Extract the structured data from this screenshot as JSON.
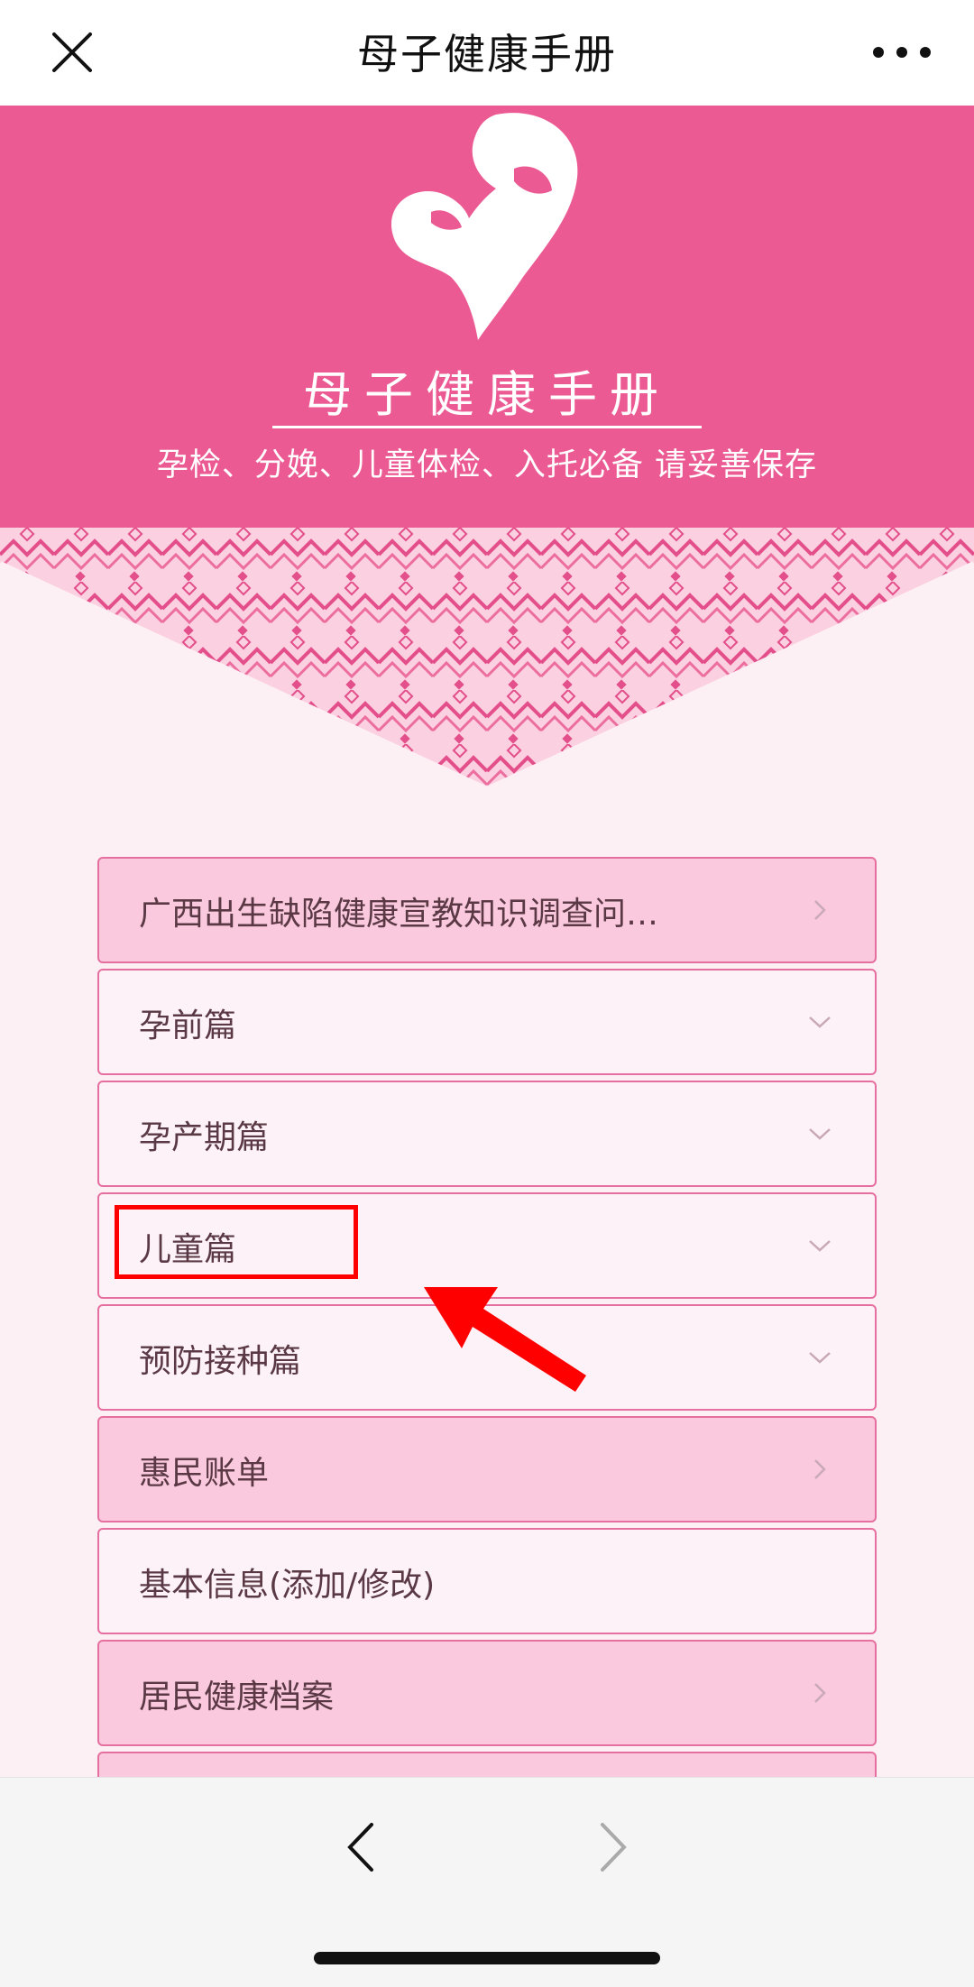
{
  "window": {
    "title": "母子健康手册"
  },
  "header": {
    "app_title": "母子健康手册",
    "subtitle": "孕检、分娩、儿童体检、入托必备 请妥善保存"
  },
  "colors": {
    "brand_pink": "#ec5a93",
    "menu_filled": "#fbc9dd",
    "menu_border": "#e56f9e",
    "annotation_red": "#ff0000"
  },
  "menu": {
    "items": [
      {
        "label": "广西出生缺陷健康宣教知识调查问…",
        "style": "filled",
        "icon": "chevron-right-icon"
      },
      {
        "label": "孕前篇",
        "style": "plain",
        "icon": "chevron-down-icon"
      },
      {
        "label": "孕产期篇",
        "style": "plain",
        "icon": "chevron-down-icon"
      },
      {
        "label": "儿童篇",
        "style": "plain",
        "icon": "chevron-down-icon",
        "highlighted": true
      },
      {
        "label": "预防接种篇",
        "style": "plain",
        "icon": "chevron-down-icon"
      },
      {
        "label": "惠民账单",
        "style": "filled",
        "icon": "chevron-right-icon"
      },
      {
        "label": "基本信息(添加/修改)",
        "style": "plain",
        "icon": ""
      },
      {
        "label": "居民健康档案",
        "style": "filled",
        "icon": "chevron-right-icon"
      }
    ]
  },
  "bottom_nav": {
    "back_icon": "chevron-left-icon",
    "forward_icon": "chevron-right-icon"
  }
}
